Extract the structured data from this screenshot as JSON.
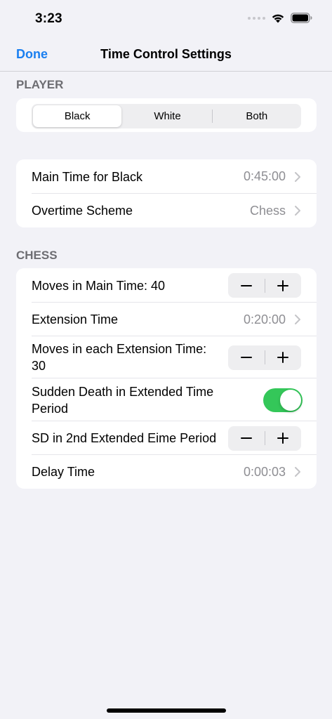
{
  "status_bar": {
    "time": "3:23"
  },
  "nav": {
    "done_label": "Done",
    "title": "Time Control Settings"
  },
  "player_section": {
    "header": "PLAYER",
    "segments": [
      "Black",
      "White",
      "Both"
    ],
    "selected": "Black"
  },
  "time_section": {
    "main_time": {
      "label": "Main Time for Black",
      "value": "0:45:00"
    },
    "overtime": {
      "label": "Overtime Scheme",
      "value": "Chess"
    }
  },
  "chess_section": {
    "header": "CHESS",
    "moves_main": {
      "label": "Moves in Main Time: 40"
    },
    "extension_time": {
      "label": "Extension Time",
      "value": "0:20:00"
    },
    "moves_extension": {
      "label_line1": "Moves in each Extension Time:",
      "label_line2": "30"
    },
    "sudden_death": {
      "label_line1": "Sudden Death in Extended Time",
      "label_line2": "Period",
      "on": true
    },
    "sd_2nd": {
      "label": "SD in 2nd Extended Eime Period"
    },
    "delay_time": {
      "label": "Delay Time",
      "value": "0:00:03"
    }
  },
  "stepper": {
    "minus": "−",
    "plus": "+"
  },
  "colors": {
    "accent": "#1a7ff0",
    "toggle_on": "#34c759",
    "background": "#f2f2f7"
  }
}
